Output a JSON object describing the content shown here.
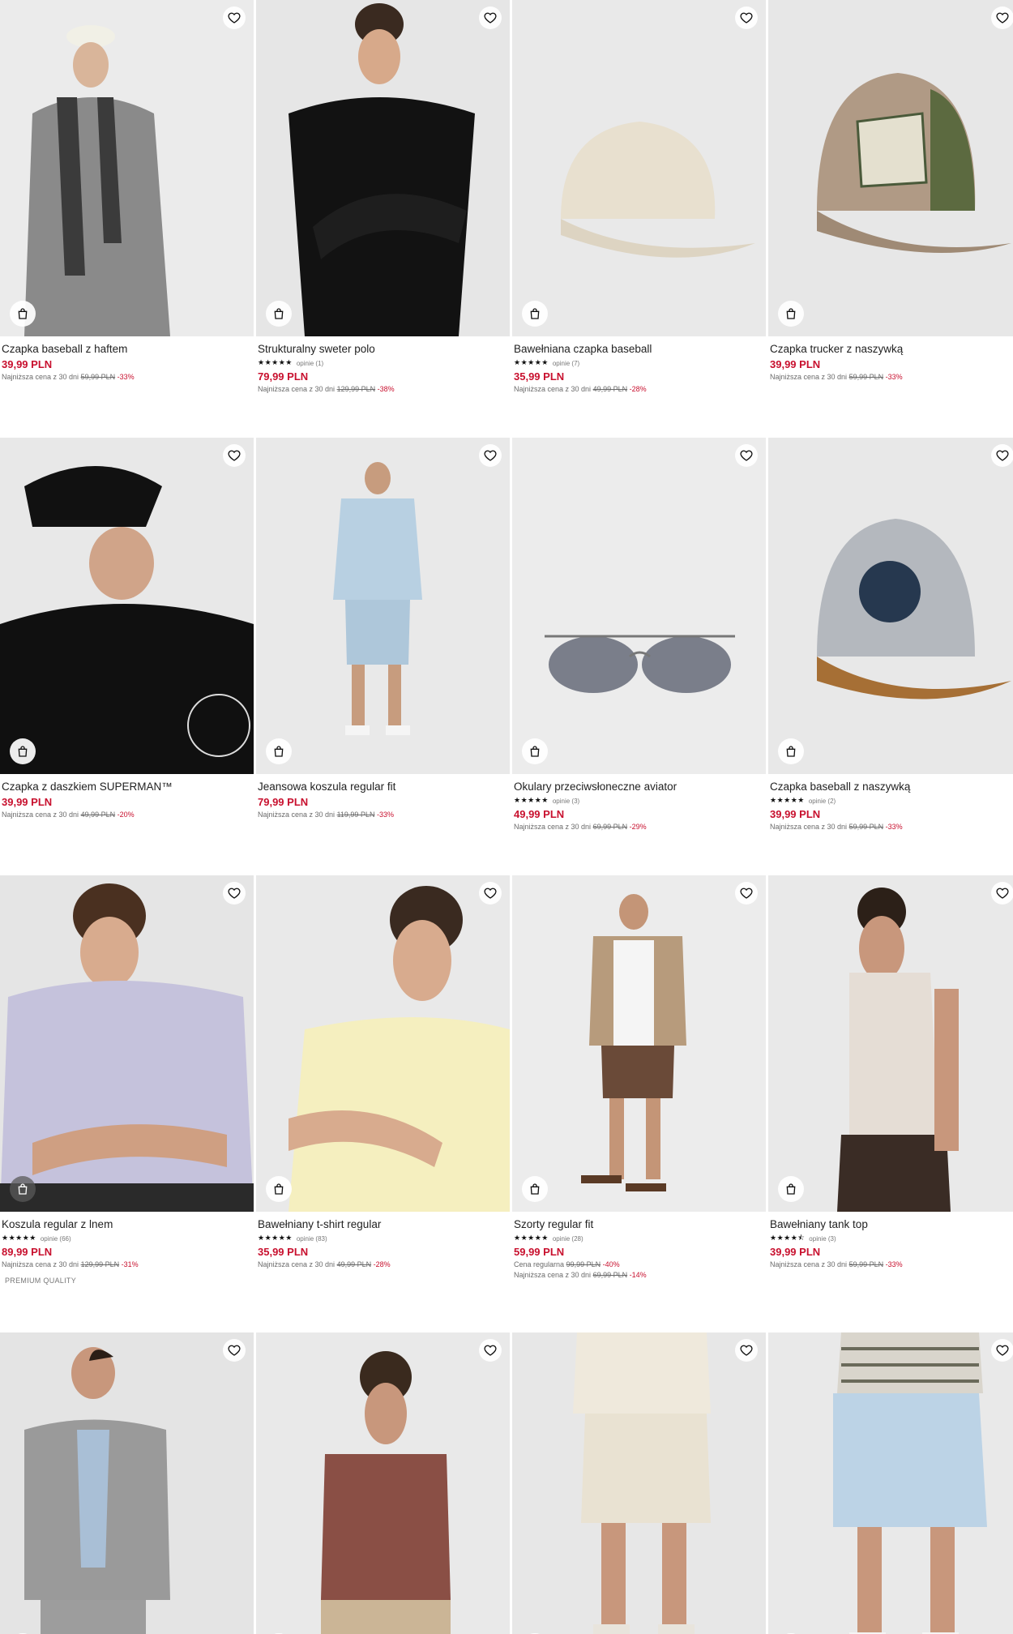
{
  "labels": {
    "lowest_prefix": "Najniższa cena z 30 dni",
    "regular_prefix": "Cena regularna"
  },
  "colors": {
    "price": "#c8102e",
    "text": "#222222"
  },
  "icons": {
    "favorite": "heart-icon",
    "cart": "shopping-bag-icon",
    "rating": "star-icon"
  },
  "products": [
    {
      "title": "Czapka baseball z haftem",
      "price": "39,99 PLN",
      "old": "59,99 PLN",
      "disc": "-33%"
    },
    {
      "title": "Strukturalny sweter polo",
      "stars": "★★★★★",
      "reviews": "opinie (1)",
      "price": "79,99 PLN",
      "old": "129,99 PLN",
      "disc": "-38%"
    },
    {
      "title": "Bawełniana czapka baseball",
      "stars": "★★★★★",
      "reviews": "opinie (7)",
      "price": "35,99 PLN",
      "old": "49,99 PLN",
      "disc": "-28%"
    },
    {
      "title": "Czapka trucker z naszywką",
      "price": "39,99 PLN",
      "old": "59,99 PLN",
      "disc": "-33%"
    },
    {
      "title": "Czapka z daszkiem SUPERMAN™",
      "price": "39,99 PLN",
      "old": "49,99 PLN",
      "disc": "-20%"
    },
    {
      "title": "Jeansowa koszula regular fit",
      "price": "79,99 PLN",
      "old": "119,99 PLN",
      "disc": "-33%"
    },
    {
      "title": "Okulary przeciwsłoneczne aviator",
      "stars": "★★★★★",
      "reviews": "opinie (3)",
      "price": "49,99 PLN",
      "old": "69,99 PLN",
      "disc": "-29%"
    },
    {
      "title": "Czapka baseball z naszywką",
      "stars": "★★★★★",
      "reviews": "opinie (2)",
      "price": "39,99 PLN",
      "old": "59,99 PLN",
      "disc": "-33%"
    },
    {
      "title": "Koszula regular z lnem",
      "stars": "★★★★★",
      "reviews": "opinie (66)",
      "price": "89,99 PLN",
      "old": "129,99 PLN",
      "disc": "-31%",
      "badge": "PREMIUM QUALITY"
    },
    {
      "title": "Bawełniany t-shirt regular",
      "stars": "★★★★★",
      "reviews": "opinie (83)",
      "price": "35,99 PLN",
      "old": "49,99 PLN",
      "disc": "-28%"
    },
    {
      "title": "Szorty regular fit",
      "stars": "★★★★★",
      "reviews": "opinie (28)",
      "price": "59,99 PLN",
      "regular_old": "99,99 PLN",
      "regular_disc": "-40%",
      "old": "69,99 PLN",
      "disc": "-14%"
    },
    {
      "title": "Bawełniany tank top",
      "stars": "★★★★⯪",
      "reviews": "opinie (3)",
      "price": "39,99 PLN",
      "old": "59,99 PLN",
      "disc": "-33%"
    },
    {
      "title": ""
    },
    {
      "title": ""
    },
    {
      "title": ""
    },
    {
      "title": ""
    }
  ]
}
